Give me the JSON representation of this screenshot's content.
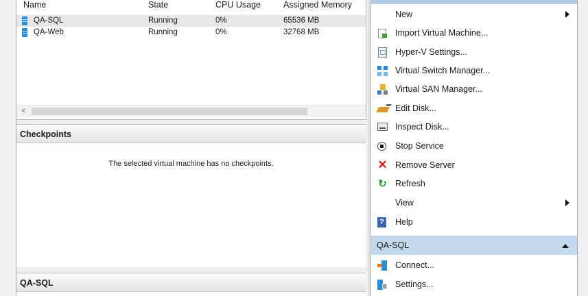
{
  "vm_list": {
    "columns": [
      "Name",
      "State",
      "CPU Usage",
      "Assigned Memory"
    ],
    "rows": [
      {
        "name": "QA-SQL",
        "state": "Running",
        "cpu": "0%",
        "memory": "65536 MB",
        "selected": true
      },
      {
        "name": "QA-Web",
        "state": "Running",
        "cpu": "0%",
        "memory": "32768 MB",
        "selected": false
      }
    ],
    "scroll_left": "<"
  },
  "checkpoints": {
    "title": "Checkpoints",
    "empty_message": "The selected virtual machine has no checkpoints."
  },
  "details": {
    "title": "QA-SQL"
  },
  "actions": {
    "host_items": [
      {
        "label": "New",
        "icon": "none",
        "submenu": true
      },
      {
        "label": "Import Virtual Machine...",
        "icon": "import-icon",
        "submenu": false
      },
      {
        "label": "Hyper-V Settings...",
        "icon": "settings-icon",
        "submenu": false
      },
      {
        "label": "Virtual Switch Manager...",
        "icon": "switch-icon",
        "submenu": false
      },
      {
        "label": "Virtual SAN Manager...",
        "icon": "san-icon",
        "submenu": false
      },
      {
        "label": "Edit Disk...",
        "icon": "edit-disk-icon",
        "submenu": false
      },
      {
        "label": "Inspect Disk...",
        "icon": "inspect-disk-icon",
        "submenu": false
      },
      {
        "label": "Stop Service",
        "icon": "stop-icon",
        "submenu": false
      },
      {
        "label": "Remove Server",
        "icon": "remove-icon",
        "submenu": false
      },
      {
        "label": "Refresh",
        "icon": "refresh-icon",
        "submenu": false
      },
      {
        "label": "View",
        "icon": "none",
        "submenu": true
      },
      {
        "label": "Help",
        "icon": "help-icon",
        "submenu": false
      }
    ],
    "vm_section": {
      "title": "QA-SQL",
      "items": [
        {
          "label": "Connect...",
          "icon": "connect-icon"
        },
        {
          "label": "Settings...",
          "icon": "vm-settings-icon"
        }
      ]
    }
  },
  "glyphs": {
    "remove": "✕",
    "refresh": "↻",
    "help": "?"
  },
  "colors": {
    "header_blue": "#c3d8ec",
    "vm_icon_blue": "#2a8fd8",
    "remove_red": "#d42020",
    "refresh_green": "#2e9c32"
  }
}
